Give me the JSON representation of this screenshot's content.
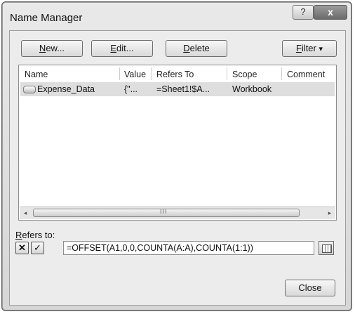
{
  "window": {
    "title": "Name Manager",
    "help_glyph": "?",
    "close_glyph": "x"
  },
  "toolbar": {
    "new_label_u": "N",
    "new_label_rest": "ew...",
    "edit_label_u": "E",
    "edit_label_rest": "dit...",
    "delete_label_u": "D",
    "delete_label_rest": "elete",
    "filter_label_u": "F",
    "filter_label_rest": "ilter",
    "filter_arrow": "▾"
  },
  "namelist": {
    "columns": [
      "Name",
      "Value",
      "Refers To",
      "Scope",
      "Comment"
    ],
    "rows": [
      {
        "name": "Expense_Data",
        "value": "{\"...",
        "refers_to": "=Sheet1!$A...",
        "scope": "Workbook",
        "comment": ""
      }
    ],
    "scroll_left": "◂",
    "scroll_right": "▸",
    "scroll_grip": "III"
  },
  "refers": {
    "label_u": "R",
    "label_rest": "efers to:",
    "cancel_glyph": "✕",
    "enter_glyph": "✓",
    "value": "=OFFSET(A1,0,0,COUNTA(A:A),COUNTA(1:1))"
  },
  "footer": {
    "close_label": "Close"
  }
}
